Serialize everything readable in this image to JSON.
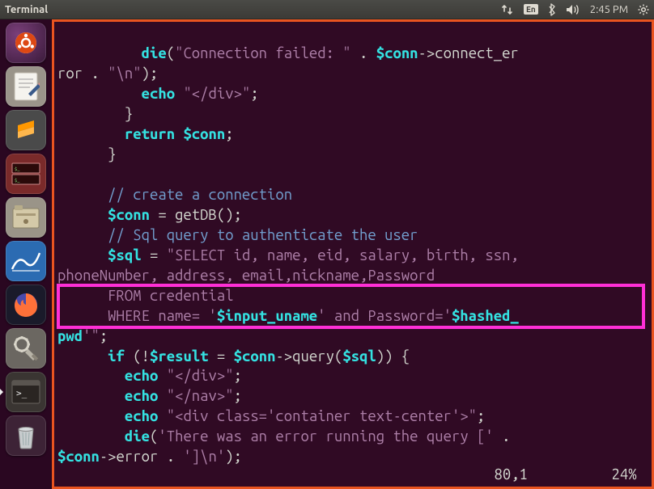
{
  "topbar": {
    "title": "Terminal",
    "lang": "En",
    "time": "2:45 PM"
  },
  "launcher": {
    "items": [
      {
        "name": "dash",
        "color": "#dd4814"
      },
      {
        "name": "text-editor",
        "color": "#e8e6e1"
      },
      {
        "name": "sublime",
        "color": "#4b4b4b"
      },
      {
        "name": "app-grid",
        "color": "#8b2e2e"
      },
      {
        "name": "files",
        "color": "#c8bfa8"
      },
      {
        "name": "wireshark",
        "color": "#2b6bb2"
      },
      {
        "name": "firefox",
        "color": "#ff7139"
      },
      {
        "name": "settings",
        "color": "#6b6761"
      },
      {
        "name": "terminal",
        "color": "#3a3532"
      },
      {
        "name": "trash",
        "color": "#a8b0b3"
      }
    ]
  },
  "code": {
    "l1a": "          ",
    "l1_die": "die",
    "l1_s1": "(",
    "l1_str": "\"Connection failed: \"",
    "l1_s2": " . ",
    "l1_var1": "$conn",
    "l1_s3": "->connect_er",
    "l2a": "ror . ",
    "l2_str": "\"\\n\"",
    "l2b": ");",
    "l3a": "          ",
    "l3_echo": "echo",
    "l3_sp": " ",
    "l3_str": "\"</div>\"",
    "l3b": ";",
    "l4a": "        }",
    "l5a": "        ",
    "l5_ret": "return",
    "l5_sp": " ",
    "l5_var": "$conn",
    "l5b": ";",
    "l6a": "      }",
    "l7": "",
    "l8a": "      ",
    "l8_c": "// create a connection",
    "l9a": "      ",
    "l9_var": "$conn",
    "l9b": " = getDB();",
    "l10a": "      ",
    "l10_c": "// Sql query to authenticate the user",
    "l11a": "      ",
    "l11_var": "$sql",
    "l11b": " = ",
    "l11_str": "\"SELECT id, name, eid, salary, birth, ssn,",
    "l12_str": "phoneNumber, address, email,nickname,Password",
    "l13_str": "      FROM credential",
    "l14a": "      WHERE name= '",
    "l14_var1": "$input_uname",
    "l14b": "' and Password='",
    "l14_var2": "$hashed_",
    "l15a": "pwd",
    "l15b": "'\"",
    "l15c": ";",
    "l16a": "      ",
    "l16_if": "if",
    "l16b": " (!",
    "l16_var1": "$result",
    "l16c": " = ",
    "l16_var2": "$conn",
    "l16d": "->query(",
    "l16_var3": "$sql",
    "l16e": ")) {",
    "l17a": "        ",
    "l17_echo": "echo",
    "l17_sp": " ",
    "l17_str": "\"</div>\"",
    "l17b": ";",
    "l18a": "        ",
    "l18_echo": "echo",
    "l18_sp": " ",
    "l18_str": "\"</nav>\"",
    "l18b": ";",
    "l19a": "        ",
    "l19_echo": "echo",
    "l19_sp": " ",
    "l19_str": "\"<div class='container text-center'>\"",
    "l19b": ";",
    "l20a": "        ",
    "l20_die": "die",
    "l20b": "(",
    "l20_str": "'There was an error running the query ['",
    "l20c": " . ",
    "l21_var": "$conn",
    "l21a": "->error . ",
    "l21_str": "']\\n'",
    "l21b": ");"
  },
  "status": {
    "pos": "80,1",
    "pct": "24%"
  }
}
